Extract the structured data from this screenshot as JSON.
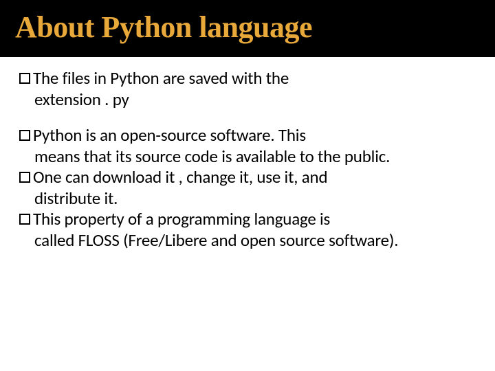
{
  "slide": {
    "title": "About Python language",
    "groups": [
      {
        "items": [
          {
            "first_line": "The files in Python are saved with the",
            "rest": "extension . py"
          }
        ]
      },
      {
        "items": [
          {
            "first_line": "Python is an open-source software. This",
            "rest": "means that its source code is available to the public."
          },
          {
            "first_line": "One can download it , change it, use it, and",
            "rest": "distribute it."
          },
          {
            "first_line": "This property of a programming language is",
            "rest": "called FLOSS (Free/Libere and open source software)."
          }
        ]
      }
    ]
  }
}
